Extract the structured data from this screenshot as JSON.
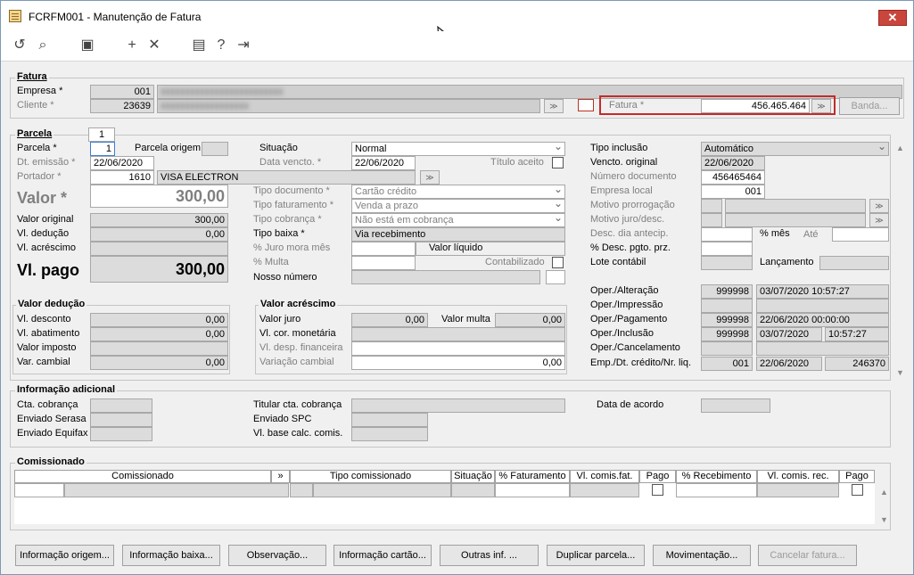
{
  "window": {
    "title": "FCRFM001 - Manutenção de Fatura"
  },
  "fatura": {
    "section_title": "Fatura",
    "empresa_label": "Empresa *",
    "empresa_code": "001",
    "cliente_label": "Cliente *",
    "cliente_code": "23639",
    "fatura_label": "Fatura *",
    "fatura_value": "456.465.464",
    "banda_label": "Banda..."
  },
  "parcela": {
    "section_title": "Parcela",
    "tab_number": "1",
    "parcela_label": "Parcela *",
    "parcela_value": "1",
    "parcela_origem_label": "Parcela origem",
    "dt_emissao_label": "Dt. emissão *",
    "dt_emissao_value": "22/06/2020",
    "portador_label": "Portador *",
    "portador_code": "1610",
    "portador_name": "VISA ELECTRON",
    "valor_label": "Valor *",
    "valor_value": "300,00",
    "valor_original_label": "Valor original",
    "valor_original_value": "300,00",
    "vl_deducao_label": "Vl. dedução",
    "vl_deducao_value": "0,00",
    "vl_acrescimo_label": "Vl. acréscimo",
    "vl_pago_label": "Vl. pago",
    "vl_pago_value": "300,00"
  },
  "middle": {
    "situacao_label": "Situação",
    "situacao_value": "Normal",
    "data_vencto_label": "Data vencto. *",
    "data_vencto_value": "22/06/2020",
    "titulo_aceito_label": "Título aceito",
    "tipo_documento_label": "Tipo documento *",
    "tipo_documento_value": "Cartão crédito",
    "tipo_faturamento_label": "Tipo faturamento *",
    "tipo_faturamento_value": "Venda a prazo",
    "tipo_cobranca_label": "Tipo cobrança *",
    "tipo_cobranca_value": "Não está em cobrança",
    "tipo_baixa_label": "Tipo baixa *",
    "tipo_baixa_value": "Via recebimento",
    "juro_mora_label": "% Juro mora mês",
    "valor_liquido_label": "Valor líquido",
    "multa_label": "% Multa",
    "contabilizado_label": "Contabilizado",
    "nosso_numero_label": "Nosso número"
  },
  "right": {
    "tipo_inclusao_label": "Tipo inclusão",
    "tipo_inclusao_value": "Automático",
    "vencto_original_label": "Vencto. original",
    "vencto_original_value": "22/06/2020",
    "numero_documento_label": "Número documento",
    "numero_documento_value": "456465464",
    "empresa_local_label": "Empresa local",
    "empresa_local_value": "001",
    "motivo_prorrogacao_label": "Motivo prorrogação",
    "motivo_juro_label": "Motivo juro/desc.",
    "desc_dia_antecip_label": "Desc. dia antecip.",
    "pct_mes_label": "% mês",
    "ate_label": "Até",
    "desc_pgto_label": "% Desc. pgto. prz.",
    "lote_contabil_label": "Lote contábil",
    "lancamento_label": "Lançamento"
  },
  "operations": [
    {
      "label": "Oper./Alteração",
      "user": "999998",
      "datetime": "03/07/2020 10:57:27"
    },
    {
      "label": "Oper./Impressão",
      "user": "",
      "datetime": ""
    },
    {
      "label": "Oper./Pagamento",
      "user": "999998",
      "datetime": "22/06/2020 00:00:00"
    },
    {
      "label": "Oper./Inclusão",
      "user": "999998",
      "date": "03/07/2020",
      "time": "10:57:27"
    },
    {
      "label": "Oper./Cancelamento",
      "user": "",
      "datetime": ""
    },
    {
      "label": "Emp./Dt. crédito/Nr. liq.",
      "user": "001",
      "date": "22/06/2020",
      "time": "246370"
    }
  ],
  "valor_deducao": {
    "title": "Valor dedução",
    "vl_desconto_label": "Vl. desconto",
    "vl_desconto_value": "0,00",
    "vl_abatimento_label": "Vl. abatimento",
    "vl_abatimento_value": "0,00",
    "valor_imposto_label": "Valor imposto",
    "var_cambial_label": "Var. cambial",
    "var_cambial_value": "0,00"
  },
  "valor_acrescimo": {
    "title": "Valor acréscimo",
    "valor_juro_label": "Valor juro",
    "valor_juro_value": "0,00",
    "valor_multa_label": "Valor multa",
    "valor_multa_value": "0,00",
    "vl_cor_monetaria_label": "Vl. cor. monetária",
    "vl_desp_financeira_label": "Vl. desp. financeira",
    "variacao_cambial_label": "Variação cambial",
    "variacao_cambial_value": "0,00"
  },
  "info_adicional": {
    "title": "Informação adicional",
    "cta_cobranca_label": "Cta. cobrança",
    "enviado_serasa_label": "Enviado Serasa",
    "enviado_equifax_label": "Enviado Equifax",
    "titular_cta_label": "Titular cta. cobrança",
    "enviado_spc_label": "Enviado SPC",
    "vl_base_calc_label": "Vl. base calc. comis.",
    "data_acordo_label": "Data de acordo"
  },
  "comissionado": {
    "title": "Comissionado",
    "columns": [
      "Comissionado",
      "»",
      "Tipo comissionado",
      "Situação",
      "% Faturamento",
      "Vl. comis.fat.",
      "Pago",
      "% Recebimento",
      "Vl. comis. rec.",
      "Pago"
    ]
  },
  "buttons": [
    "Informação origem...",
    "Informação baixa...",
    "Observação...",
    "Informação cartão...",
    "Outras inf. ...",
    "Duplicar parcela...",
    "Movimentação...",
    "Cancelar fatura..."
  ]
}
